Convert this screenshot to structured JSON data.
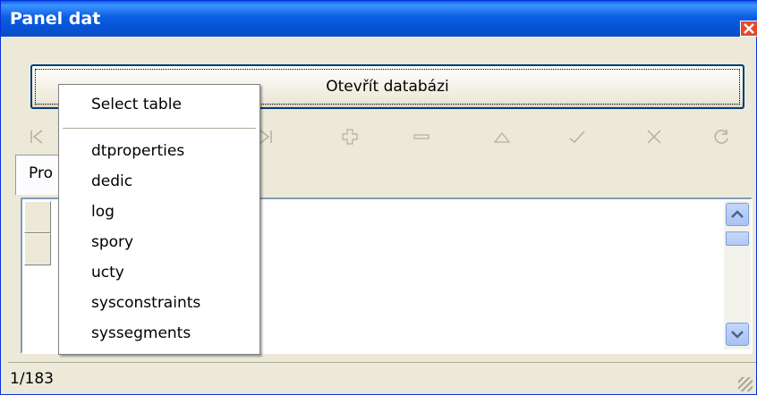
{
  "window": {
    "title": "Panel dat",
    "close_icon": "close-icon"
  },
  "open_button": {
    "label": "Otevřít databázi"
  },
  "navigator": {
    "icons": [
      "first-record-icon",
      "last-record-icon",
      "insert-record-icon",
      "delete-record-icon",
      "edit-record-icon",
      "post-record-icon",
      "cancel-record-icon",
      "refresh-icon"
    ]
  },
  "tab": {
    "label": "Pro"
  },
  "status": {
    "record_position": "1/183"
  },
  "popup": {
    "header": "Select table",
    "items": [
      "dtproperties",
      "dedic",
      "log",
      "spory",
      "ucty",
      "sysconstraints",
      "syssegments"
    ]
  },
  "colors": {
    "titlebar": "#0b5ee3",
    "close_button": "#e34a2a",
    "window_face": "#ece9d8"
  }
}
